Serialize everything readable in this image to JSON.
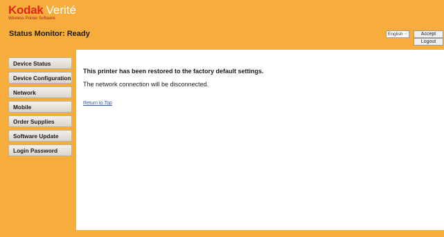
{
  "brand": {
    "logo_text": "Kodak",
    "product_name": "Verité",
    "tagline": "Wireless Printer Software"
  },
  "header": {
    "status_title": "Status Monitor: Ready",
    "language": {
      "selected": "English"
    },
    "accept_label": "Accept",
    "logout_label": "Logout"
  },
  "sidebar": {
    "items": [
      {
        "label": "Device Status"
      },
      {
        "label": "Device Configuration"
      },
      {
        "label": "Network"
      },
      {
        "label": "Mobile"
      },
      {
        "label": "Order Supplies"
      },
      {
        "label": "Software Update"
      },
      {
        "label": "Login Password"
      }
    ]
  },
  "main": {
    "message_title": "This printer has been restored to the factory default settings.",
    "message_detail": "The network connection will be disconnected.",
    "return_link": "Return to Top"
  },
  "colors": {
    "background": "#f6ad3c",
    "brand_red": "#e3261b",
    "link": "#3355aa"
  }
}
